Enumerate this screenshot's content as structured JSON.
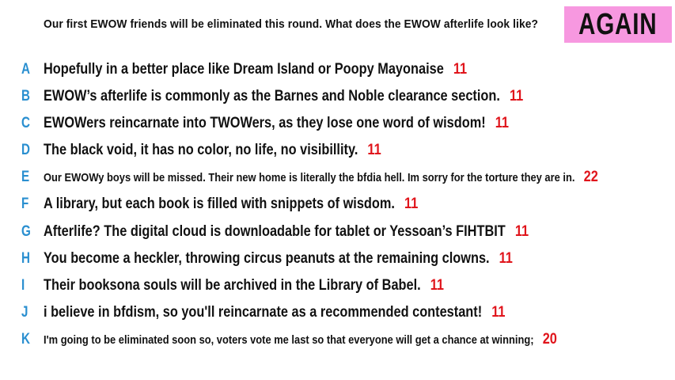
{
  "prompt": "Our first EWOW friends will be eliminated this round. What does the EWOW afterlife look like?",
  "badge": "AGAIN",
  "colors": {
    "letter": "#2a8fd0",
    "score": "#e0141b",
    "badge_bg": "#f798e0"
  },
  "responses": [
    {
      "letter": "A",
      "text": "Hopefully in a better place like Dream Island or Poopy Mayonaise",
      "score": "11"
    },
    {
      "letter": "B",
      "text": "EWOW’s afterlife is commonly as the Barnes and Noble clearance section.",
      "score": "11"
    },
    {
      "letter": "C",
      "text": "EWOWers reincarnate into TWOWers, as they lose one word of wisdom!",
      "score": "11"
    },
    {
      "letter": "D",
      "text": "The black void, it has no color, no life, no visibillity.",
      "score": "11"
    },
    {
      "letter": "E",
      "text": "Our EWOWy boys will be missed. Their new home is literally the bfdia hell. Im sorry for the torture they are in.",
      "score": "22"
    },
    {
      "letter": "F",
      "text": "A library, but each book is filled with snippets of wisdom.",
      "score": "11"
    },
    {
      "letter": "G",
      "text": "Afterlife? The digital cloud is downloadable for tablet or Yessoan’s FIHTBIT",
      "score": "11"
    },
    {
      "letter": "H",
      "text": "You become a heckler, throwing circus peanuts at the remaining clowns.",
      "score": "11"
    },
    {
      "letter": "I",
      "text": "Their booksona souls will be archived in the Library of Babel.",
      "score": "11"
    },
    {
      "letter": "J",
      "text": "i believe in bfdism, so you'll reincarnate as a recommended contestant!",
      "score": "11"
    },
    {
      "letter": "K",
      "text": "I'm going to be eliminated soon so, voters vote me last so that everyone will get a chance at winning;",
      "score": "20"
    }
  ]
}
